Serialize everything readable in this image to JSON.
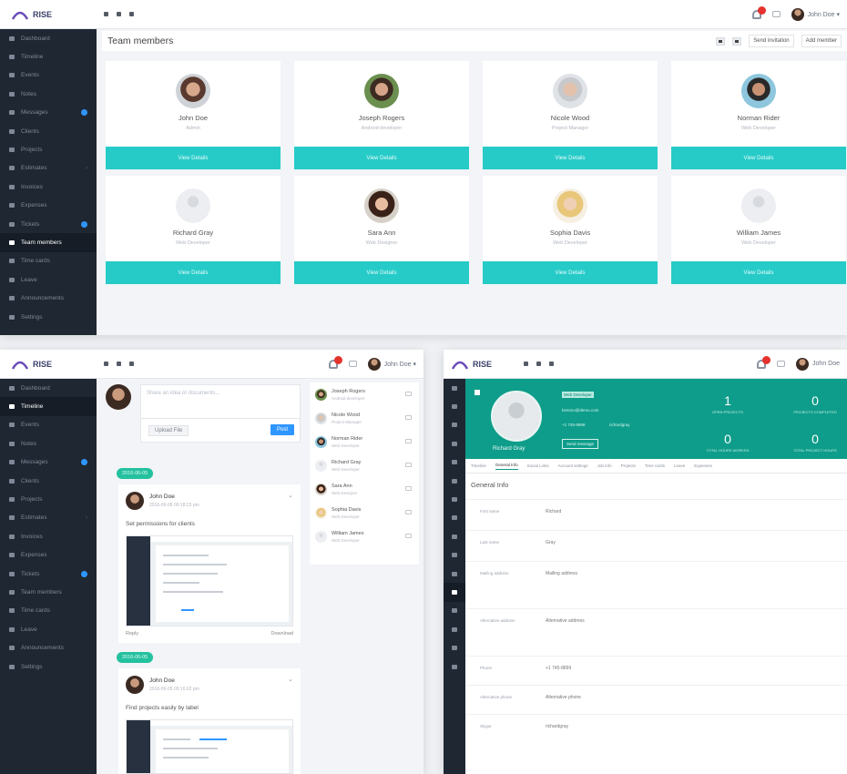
{
  "app": {
    "logo_text": "RISE",
    "user_name": "John Doe",
    "user_name_short": "John Doe ▾"
  },
  "colors": {
    "sidebar": "#1f2733",
    "accent_teal": "#26cbc8",
    "profile_green": "#0e9d8a",
    "primary_blue": "#2f96ff",
    "badge_red": "#e5322d"
  },
  "sidebar_items": [
    {
      "label": "Dashboard",
      "icon": "desktop-icon"
    },
    {
      "label": "Timeline",
      "icon": "comments-icon"
    },
    {
      "label": "Events",
      "icon": "calendar-icon"
    },
    {
      "label": "Notes",
      "icon": "book-icon"
    },
    {
      "label": "Messages",
      "icon": "envelope-icon",
      "badge": true
    },
    {
      "label": "Clients",
      "icon": "briefcase-icon"
    },
    {
      "label": "Projects",
      "icon": "th-large-icon"
    },
    {
      "label": "Estimates",
      "icon": "file-icon",
      "chevron": true
    },
    {
      "label": "Invoices",
      "icon": "file-text-icon"
    },
    {
      "label": "Expenses",
      "icon": "list-icon"
    },
    {
      "label": "Tickets",
      "icon": "ticket-icon",
      "badge": true
    },
    {
      "label": "Team members",
      "icon": "user-icon"
    },
    {
      "label": "Time cards",
      "icon": "clock-icon"
    },
    {
      "label": "Leave",
      "icon": "plane-icon"
    },
    {
      "label": "Announcements",
      "icon": "bullhorn-icon"
    },
    {
      "label": "Settings",
      "icon": "wrench-icon"
    }
  ],
  "team": {
    "title": "Team members",
    "actions": {
      "send_invitation": "Send invitation",
      "add_member": "Add member"
    },
    "view_details": "View Details",
    "members": [
      {
        "name": "John Doe",
        "role": "Admin"
      },
      {
        "name": "Joseph Rogers",
        "role": "Android developer"
      },
      {
        "name": "Nicole Wood",
        "role": "Project Manager"
      },
      {
        "name": "Norman Rider",
        "role": "Web Developer"
      },
      {
        "name": "Richard Gray",
        "role": "Web Developer"
      },
      {
        "name": "Sara Ann",
        "role": "Web Designer"
      },
      {
        "name": "Sophia Davis",
        "role": "Web Developer"
      },
      {
        "name": "William James",
        "role": "Web Developer"
      }
    ]
  },
  "timeline": {
    "compose_placeholder": "Share an idea or documents...",
    "upload_label": "Upload File",
    "post_label": "Post",
    "date_pill": "2016-06-05",
    "posts": [
      {
        "author": "John Doe",
        "sub": "2016-06-05 09:18:23 pm",
        "text": "Set permissions for clients",
        "reply": "Reply",
        "download": "Download"
      },
      {
        "author": "John Doe",
        "sub": "2016-06-05 09:16:02 pm",
        "text": "Find projects easily by label"
      }
    ],
    "members": [
      {
        "name": "Joseph Rogers",
        "role": "Android developer"
      },
      {
        "name": "Nicole Wood",
        "role": "Project Manager"
      },
      {
        "name": "Norman Rider",
        "role": "Web Developer"
      },
      {
        "name": "Richard Gray",
        "role": "Web Developer"
      },
      {
        "name": "Sara Ann",
        "role": "Web Designer"
      },
      {
        "name": "Sophia Davis",
        "role": "Web Developer"
      },
      {
        "name": "William James",
        "role": "Web Developer"
      }
    ]
  },
  "profile": {
    "name": "Richard Gray",
    "role_tag": "Web Developer",
    "email": "lorenzo@demo.com",
    "phone": "+1 745-8899",
    "skype": "richardgray",
    "send_message": "Send message",
    "stats": [
      {
        "value": "1",
        "label": "OPEN PROJECTS"
      },
      {
        "value": "0",
        "label": "PROJECTS COMPLETED"
      },
      {
        "value": "0",
        "label": "TOTAL HOURS WORKED"
      },
      {
        "value": "0",
        "label": "TOTAL PROJECT HOURS"
      }
    ],
    "tabs": [
      "Timeline",
      "General Info",
      "Social Links",
      "Account settings",
      "Job Info",
      "Projects",
      "Time cards",
      "Leave",
      "Expenses"
    ],
    "active_tab": "General Info",
    "section_title": "General Info",
    "fields": [
      {
        "label": "First name",
        "value": "Richard"
      },
      {
        "label": "Last name",
        "value": "Gray"
      },
      {
        "label": "Mailing address",
        "value": "Mailing address"
      },
      {
        "label": "Alternative address",
        "value": "Alternative address"
      },
      {
        "label": "Phone",
        "value": "+1 745-8899"
      },
      {
        "label": "Alternative phone",
        "value": "Alternative phone"
      },
      {
        "label": "Skype",
        "value": "richardgray"
      }
    ]
  }
}
